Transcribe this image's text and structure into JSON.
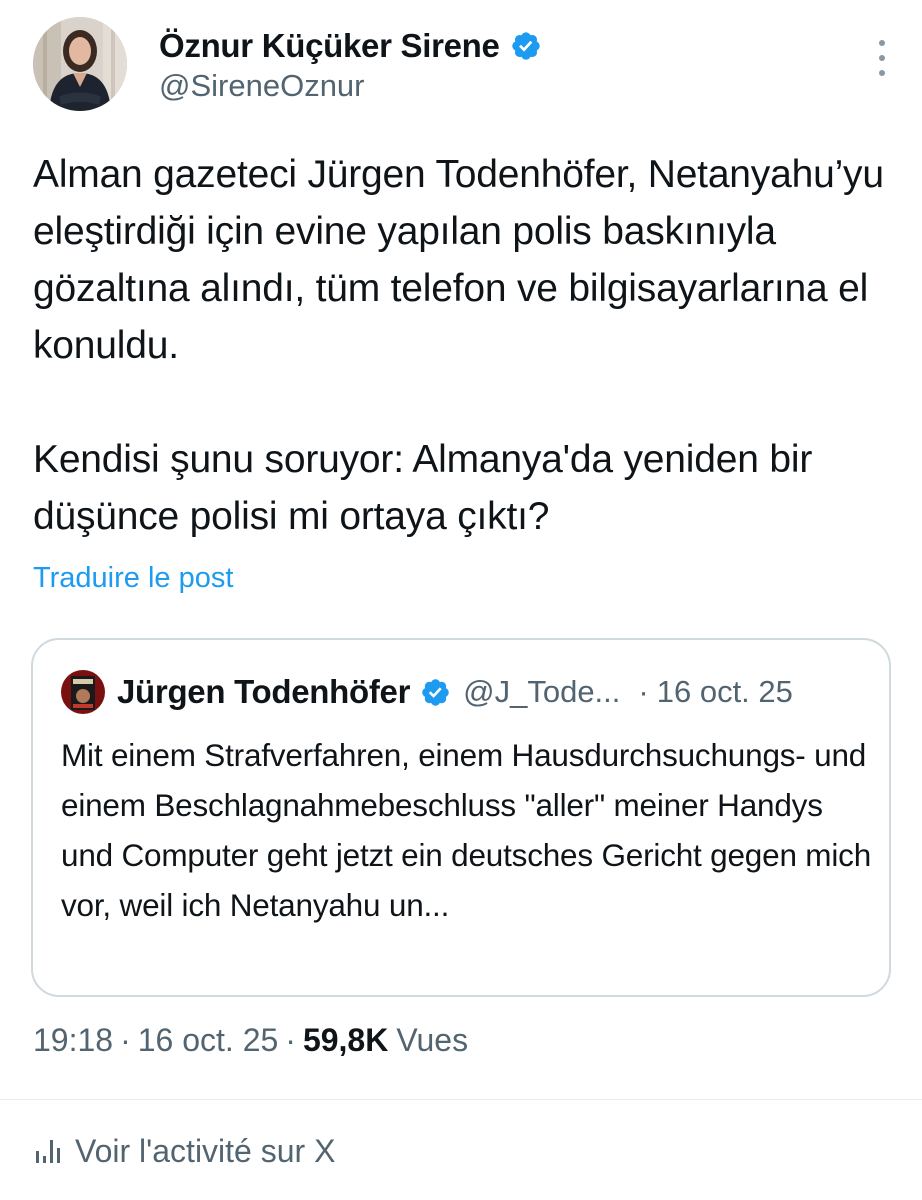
{
  "tweet": {
    "author": {
      "name": "Öznur Küçüker Sirene",
      "handle": "@SireneOznur",
      "verified": true
    },
    "text_paragraphs": [
      "Alman gazeteci Jürgen Todenhöfer, Netanyahu’yu eleştirdiği için evine yapılan polis baskınıyla gözaltına alındı, tüm telefon ve bilgisayarlarına el konuldu.",
      "Kendisi şunu soruyor: Almanya'da yeniden bir düşünce polisi mi ortaya çıktı?"
    ],
    "translate_label": "Traduire le post",
    "quoted_tweet": {
      "author_name": "Jürgen Todenhöfer",
      "verified": true,
      "handle": "@J_Tode...",
      "separator": "·",
      "date": "16 oct. 25",
      "text": "Mit einem Strafverfahren, einem Hausdurchsuchungs- und einem Beschlagnahmebeschluss \"aller\" meiner Handys und Computer geht jetzt ein deutsches Gericht gegen mich vor, weil ich Netanyahu un..."
    },
    "meta": {
      "time": "19:18",
      "separator": "·",
      "date": "16 oct. 25",
      "views_count": "59,8K",
      "views_label": "Vues"
    },
    "activity_label": "Voir l'activité sur X"
  },
  "colors": {
    "text_primary": "#0f1419",
    "text_secondary": "#536471",
    "link_blue": "#1d9bf0",
    "verified_blue": "#1d9bf0",
    "border": "#cfd9de"
  },
  "icons": {
    "verified": "verified-badge-icon",
    "more": "more-options-icon",
    "activity": "bar-chart-icon"
  }
}
